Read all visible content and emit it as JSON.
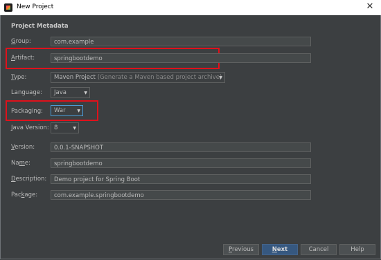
{
  "window": {
    "title": "New Project",
    "close_glyph": "✕",
    "icon": "intellij-app-icon"
  },
  "section_title": "Project Metadata",
  "fields": {
    "group": {
      "label_mnemonic": "G",
      "label_rest": "roup:",
      "value": "com.example"
    },
    "artifact": {
      "label_mnemonic": "A",
      "label_rest": "rtifact:",
      "value": "springbootdemo"
    },
    "type": {
      "label_mnemonic": "T",
      "label_rest": "ype:",
      "value": "Maven Project",
      "hint": "(Generate a Maven based project archive)"
    },
    "language": {
      "label": "Language:",
      "value": "Java"
    },
    "packaging": {
      "label": "Packaging:",
      "value": "War"
    },
    "java_version": {
      "label_mnemonic": "J",
      "label_rest": "ava Version:",
      "value": "8"
    },
    "version": {
      "label_mnemonic": "V",
      "label_rest": "ersion:",
      "value": "0.0.1-SNAPSHOT"
    },
    "name": {
      "label_pre": "Na",
      "label_mnemonic": "m",
      "label_rest": "e:",
      "value": "springbootdemo"
    },
    "description": {
      "label_mnemonic": "D",
      "label_rest": "escription:",
      "value": "Demo project for Spring Boot"
    },
    "package": {
      "label_pre": "Pac",
      "label_mnemonic": "k",
      "label_rest": "age:",
      "value": "com.example.springbootdemo"
    }
  },
  "buttons": {
    "previous": {
      "mnemonic": "P",
      "rest": "revious"
    },
    "next": {
      "mnemonic": "N",
      "rest": "ext"
    },
    "cancel": "Cancel",
    "help": "Help"
  },
  "dropdown_glyph": "▼",
  "colors": {
    "highlight_box": "#e0111b",
    "default_button": "#365880",
    "background": "#3c3f41"
  }
}
